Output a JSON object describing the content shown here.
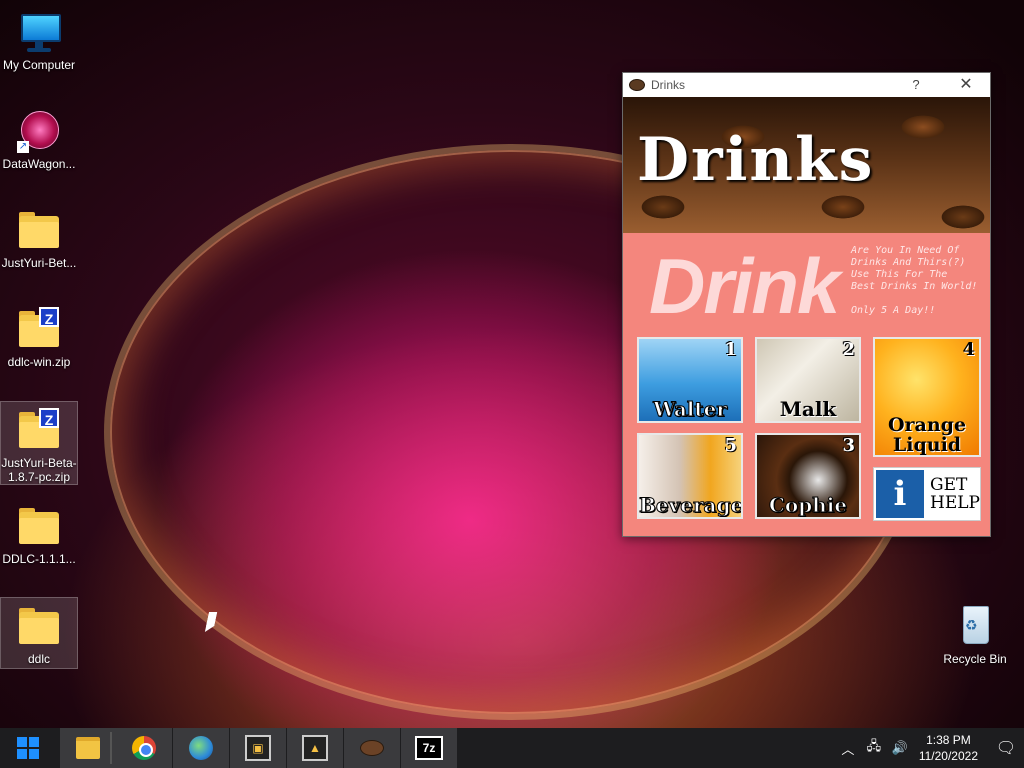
{
  "desktop": {
    "icons": [
      {
        "label": "My Computer"
      },
      {
        "label": "DataWagon..."
      },
      {
        "label": "JustYuri-Bet..."
      },
      {
        "label": "ddlc-win.zip"
      },
      {
        "label": "JustYuri-Beta-1.8.7-pc.zip"
      },
      {
        "label": "DDLC-1.1.1..."
      },
      {
        "label": "ddlc"
      },
      {
        "label": "Recycle Bin"
      }
    ]
  },
  "window": {
    "title": "Drinks",
    "help": "?",
    "close": "✕",
    "banner_title": "Drinks",
    "big_text": "Drink",
    "promo_lines": [
      "Are You In Need Of",
      "Drinks And Thirs(?)",
      "Use This For The",
      "Best Drinks In World!",
      "",
      "Only 5 A Day!!"
    ],
    "tiles": [
      {
        "label": "Walter",
        "num": "1"
      },
      {
        "label": "Malk",
        "num": "2"
      },
      {
        "label": "Orange Liquid",
        "num": "4"
      },
      {
        "label": "Beverage",
        "num": "5"
      },
      {
        "label": "Cophie",
        "num": "3"
      }
    ],
    "help_tile": {
      "icon_letter": "i",
      "line1": "GET",
      "line2": "HELP"
    }
  },
  "taskbar": {
    "time": "1:38 PM",
    "date": "11/20/2022",
    "apps_7z": "7z"
  },
  "colors": {
    "pink_panel": "#f4867d",
    "taskbar": "#1d1d1f",
    "accent_blue": "#1e90ff"
  }
}
